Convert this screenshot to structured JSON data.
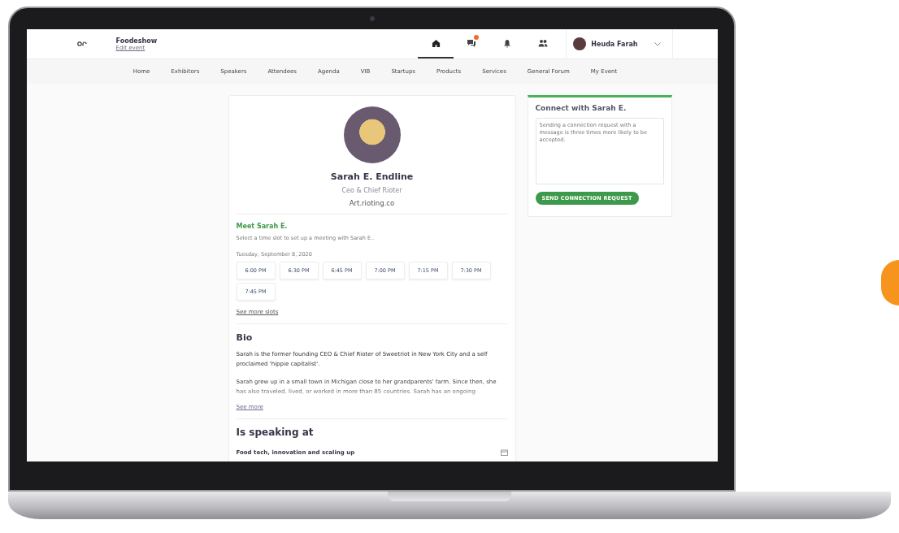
{
  "app": {
    "event_name": "Foodeshow",
    "edit_link": "Edit event",
    "top_icons": [
      {
        "kind": "home",
        "selected": true,
        "has_badge": false
      },
      {
        "kind": "chat",
        "selected": false,
        "has_badge": true
      },
      {
        "kind": "bell",
        "selected": false,
        "has_badge": false
      },
      {
        "kind": "people",
        "selected": false,
        "has_badge": false
      }
    ],
    "user": {
      "name": "Heuda Farah"
    },
    "nav": [
      "Home",
      "Exhibitors",
      "Speakers",
      "Attendees",
      "Agenda",
      "VIB",
      "Startups",
      "Products",
      "Services",
      "General Forum",
      "My Event"
    ]
  },
  "profile": {
    "name": "Sarah E. Endline",
    "title": "Ceo & Chief Rioter",
    "website": "Art.rioting.co"
  },
  "meeting": {
    "heading": "Meet Sarah E.",
    "description": "Select a time slot to set up a meeting with Sarah E..",
    "date": "Tuesday, September 8, 2020",
    "slots": [
      "6:00 PM",
      "6:30 PM",
      "6:45 PM",
      "7:00 PM",
      "7:15 PM",
      "7:30 PM",
      "7:45 PM"
    ],
    "more_link": "See more slots"
  },
  "bio": {
    "heading": "Bio",
    "paragraphs": [
      "Sarah is the former founding CEO & Chief Rioter of Sweetriot in New York City and a self proclaimed 'hippie capitalist'.",
      "Sarah grew up in a small town in Michigan close to her grandparents' farm. Since then, she has also traveled, lived, or worked in more than 85 countries. Sarah has an ongoing"
    ],
    "more_link": "See more"
  },
  "speaking": {
    "heading": "Is speaking at",
    "sessions": [
      "Food tech, innovation and scaling up"
    ]
  },
  "connect": {
    "heading": "Connect with Sarah E.",
    "placeholder": "Sending a connection request with a message is three times more likely to be accepted.",
    "button": "SEND CONNECTION REQUEST"
  }
}
